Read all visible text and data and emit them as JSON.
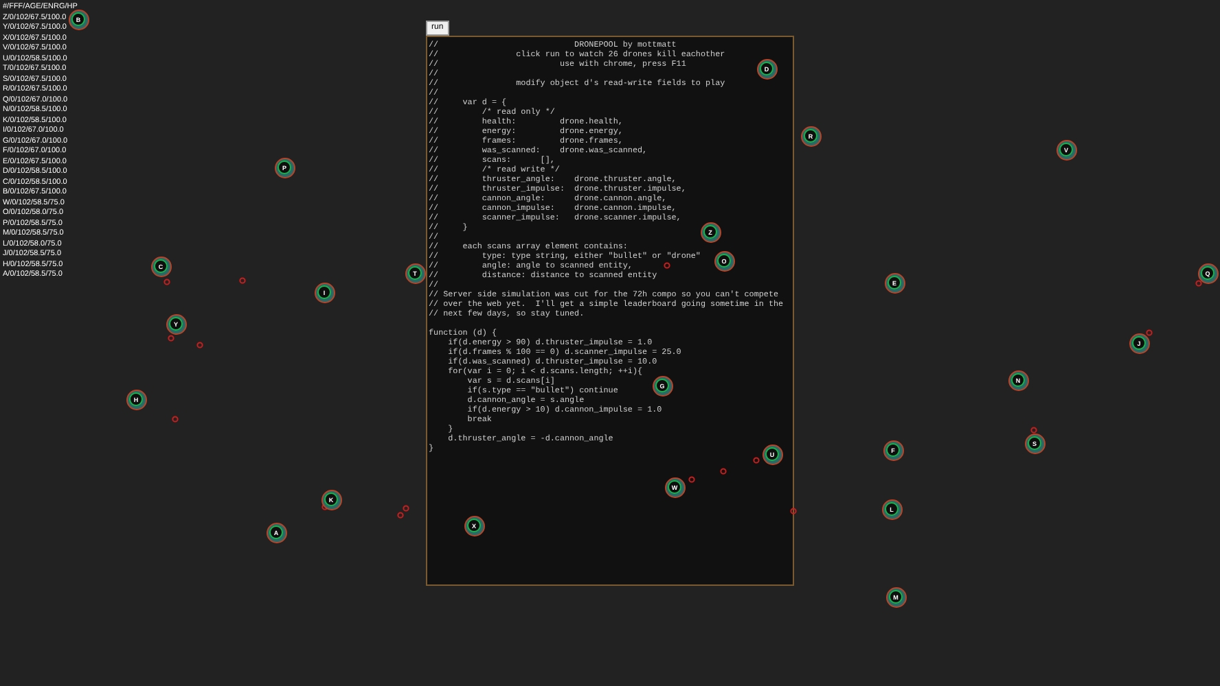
{
  "stats": {
    "header": "#/FFF/AGE/ENRG/HP",
    "rows": [
      "Z/0/102/67.5/100.0",
      "Y/0/102/67.5/100.0",
      "X/0/102/67.5/100.0",
      "V/0/102/67.5/100.0",
      "U/0/102/58.5/100.0",
      "T/0/102/67.5/100.0",
      "S/0/102/67.5/100.0",
      "R/0/102/67.5/100.0",
      "Q/0/102/67.0/100.0",
      "N/0/102/58.5/100.0",
      "K/0/102/58.5/100.0",
      "I/0/102/67.0/100.0",
      "G/0/102/67.0/100.0",
      "F/0/102/67.0/100.0",
      "E/0/102/67.5/100.0",
      "D/0/102/58.5/100.0",
      "C/0/102/58.5/100.0",
      "B/0/102/67.5/100.0",
      "W/0/102/58.5/75.0",
      "O/0/102/58.0/75.0",
      "P/0/102/58.5/75.0",
      "M/0/102/58.5/75.0",
      "L/0/102/58.0/75.0",
      "J/0/102/58.5/75.0",
      "H/0/102/58.5/75.0",
      "A/0/102/58.5/75.0"
    ]
  },
  "run_button": "run",
  "code": "//                            DRONEPOOL by mottmatt\n//                click run to watch 26 drones kill eachother\n//                         use with chrome, press F11\n//\n//                modify object d's read-write fields to play\n//\n//     var d = {\n//         /* read only */\n//         health:         drone.health,\n//         energy:         drone.energy,\n//         frames:         drone.frames,\n//         was_scanned:    drone.was_scanned,\n//         scans:      [],\n//         /* read write */\n//         thruster_angle:    drone.thruster.angle,\n//         thruster_impulse:  drone.thruster.impulse,\n//         cannon_angle:      drone.cannon.angle,\n//         cannon_impulse:    drone.cannon.impulse,\n//         scanner_impulse:   drone.scanner.impulse,\n//     }\n//\n//     each scans array element contains:\n//         type: type string, either \"bullet\" or \"drone\"\n//         angle: angle to scanned entity,\n//         distance: distance to scanned entity\n//\n// Server side simulation was cut for the 72h compo so you can't compete\n// over the web yet.  I'll get a simple leaderboard going sometime in the\n// next few days, so stay tuned.\n\nfunction (d) {\n    if(d.energy > 90) d.thruster_impulse = 1.0\n    if(d.frames % 100 == 0) d.scanner_impulse = 25.0\n    if(d.was_scanned) d.thruster_impulse = 10.0\n    for(var i = 0; i < d.scans.length; ++i){\n        var s = d.scans[i]\n        if(s.type == \"bullet\") continue\n        d.cannon_angle = s.angle\n        if(d.energy > 10) d.cannon_impulse = 1.0\n        break\n    }\n    d.thruster_angle = -d.cannon_angle\n}",
  "drones": [
    {
      "label": "B"
    },
    {
      "label": "P"
    },
    {
      "label": "C"
    },
    {
      "label": "I"
    },
    {
      "label": "Y"
    },
    {
      "label": "H"
    },
    {
      "label": "K"
    },
    {
      "label": "A"
    },
    {
      "label": "D"
    },
    {
      "label": "T"
    },
    {
      "label": "O"
    },
    {
      "label": "G"
    },
    {
      "label": "X"
    },
    {
      "label": "Z"
    },
    {
      "label": "R"
    },
    {
      "label": "E"
    },
    {
      "label": "V"
    },
    {
      "label": "Q"
    },
    {
      "label": "J"
    },
    {
      "label": "N"
    },
    {
      "label": "S"
    },
    {
      "label": "F"
    },
    {
      "label": "U"
    },
    {
      "label": "W"
    },
    {
      "label": "L"
    },
    {
      "label": "M"
    }
  ]
}
